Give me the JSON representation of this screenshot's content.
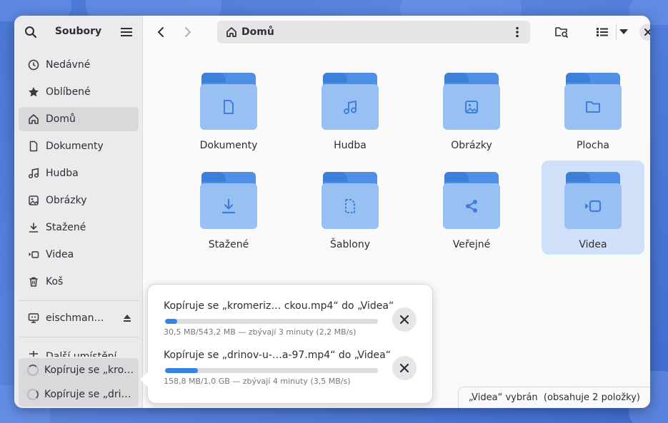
{
  "sidebar": {
    "title": "Soubory",
    "places": [
      {
        "label": "Nedávné",
        "icon": "clock-icon"
      },
      {
        "label": "Oblíbené",
        "icon": "star-icon"
      },
      {
        "label": "Domů",
        "icon": "home-icon",
        "active": true
      },
      {
        "label": "Dokumenty",
        "icon": "document-icon"
      },
      {
        "label": "Hudba",
        "icon": "music-icon"
      },
      {
        "label": "Obrázky",
        "icon": "image-icon"
      },
      {
        "label": "Stažené",
        "icon": "download-icon"
      },
      {
        "label": "Videa",
        "icon": "video-icon"
      },
      {
        "label": "Koš",
        "icon": "trash-icon"
      }
    ],
    "network_item": {
      "label": "eischman…",
      "icon": "computer-icon"
    },
    "other_places_partial": "Další umístění",
    "operations": [
      {
        "label": "Kopíruje se „kro…"
      },
      {
        "label": "Kopíruje se „dri…"
      }
    ]
  },
  "header": {
    "path": "Domů",
    "path_icon": "home-icon"
  },
  "folders": [
    {
      "label": "Dokumenty",
      "icon": "document-icon"
    },
    {
      "label": "Hudba",
      "icon": "music-icon"
    },
    {
      "label": "Obrázky",
      "icon": "image-icon"
    },
    {
      "label": "Plocha",
      "icon": "folder-icon"
    },
    {
      "label": "Stažené",
      "icon": "download-icon"
    },
    {
      "label": "Šablony",
      "icon": "template-icon"
    },
    {
      "label": "Veřejné",
      "icon": "share-icon"
    },
    {
      "label": "Videa",
      "icon": "video-icon",
      "selected": true
    }
  ],
  "operations_popover": [
    {
      "title": "Kopíruje se „kromeriz… ckou.mp4“ do „Videa“",
      "detail": "30,5 MB/543,2 MB — zbývají 3 minuty (2,2 MB/s)",
      "progress": 0.056
    },
    {
      "title": "Kopíruje se „drinov-u-…a-97.mp4“ do „Videa“",
      "detail": "158,8 MB/1,0 GB — zbývají 4 minuty (3,5 MB/s)",
      "progress": 0.155
    }
  ],
  "status": "„Videa“ vybrán  (obsahuje 2 položky)",
  "colors": {
    "accent": "#3584e4",
    "folder_back": "#4f8fe6",
    "folder_front": "#98c0f2",
    "selection": "#cfe0f8"
  }
}
